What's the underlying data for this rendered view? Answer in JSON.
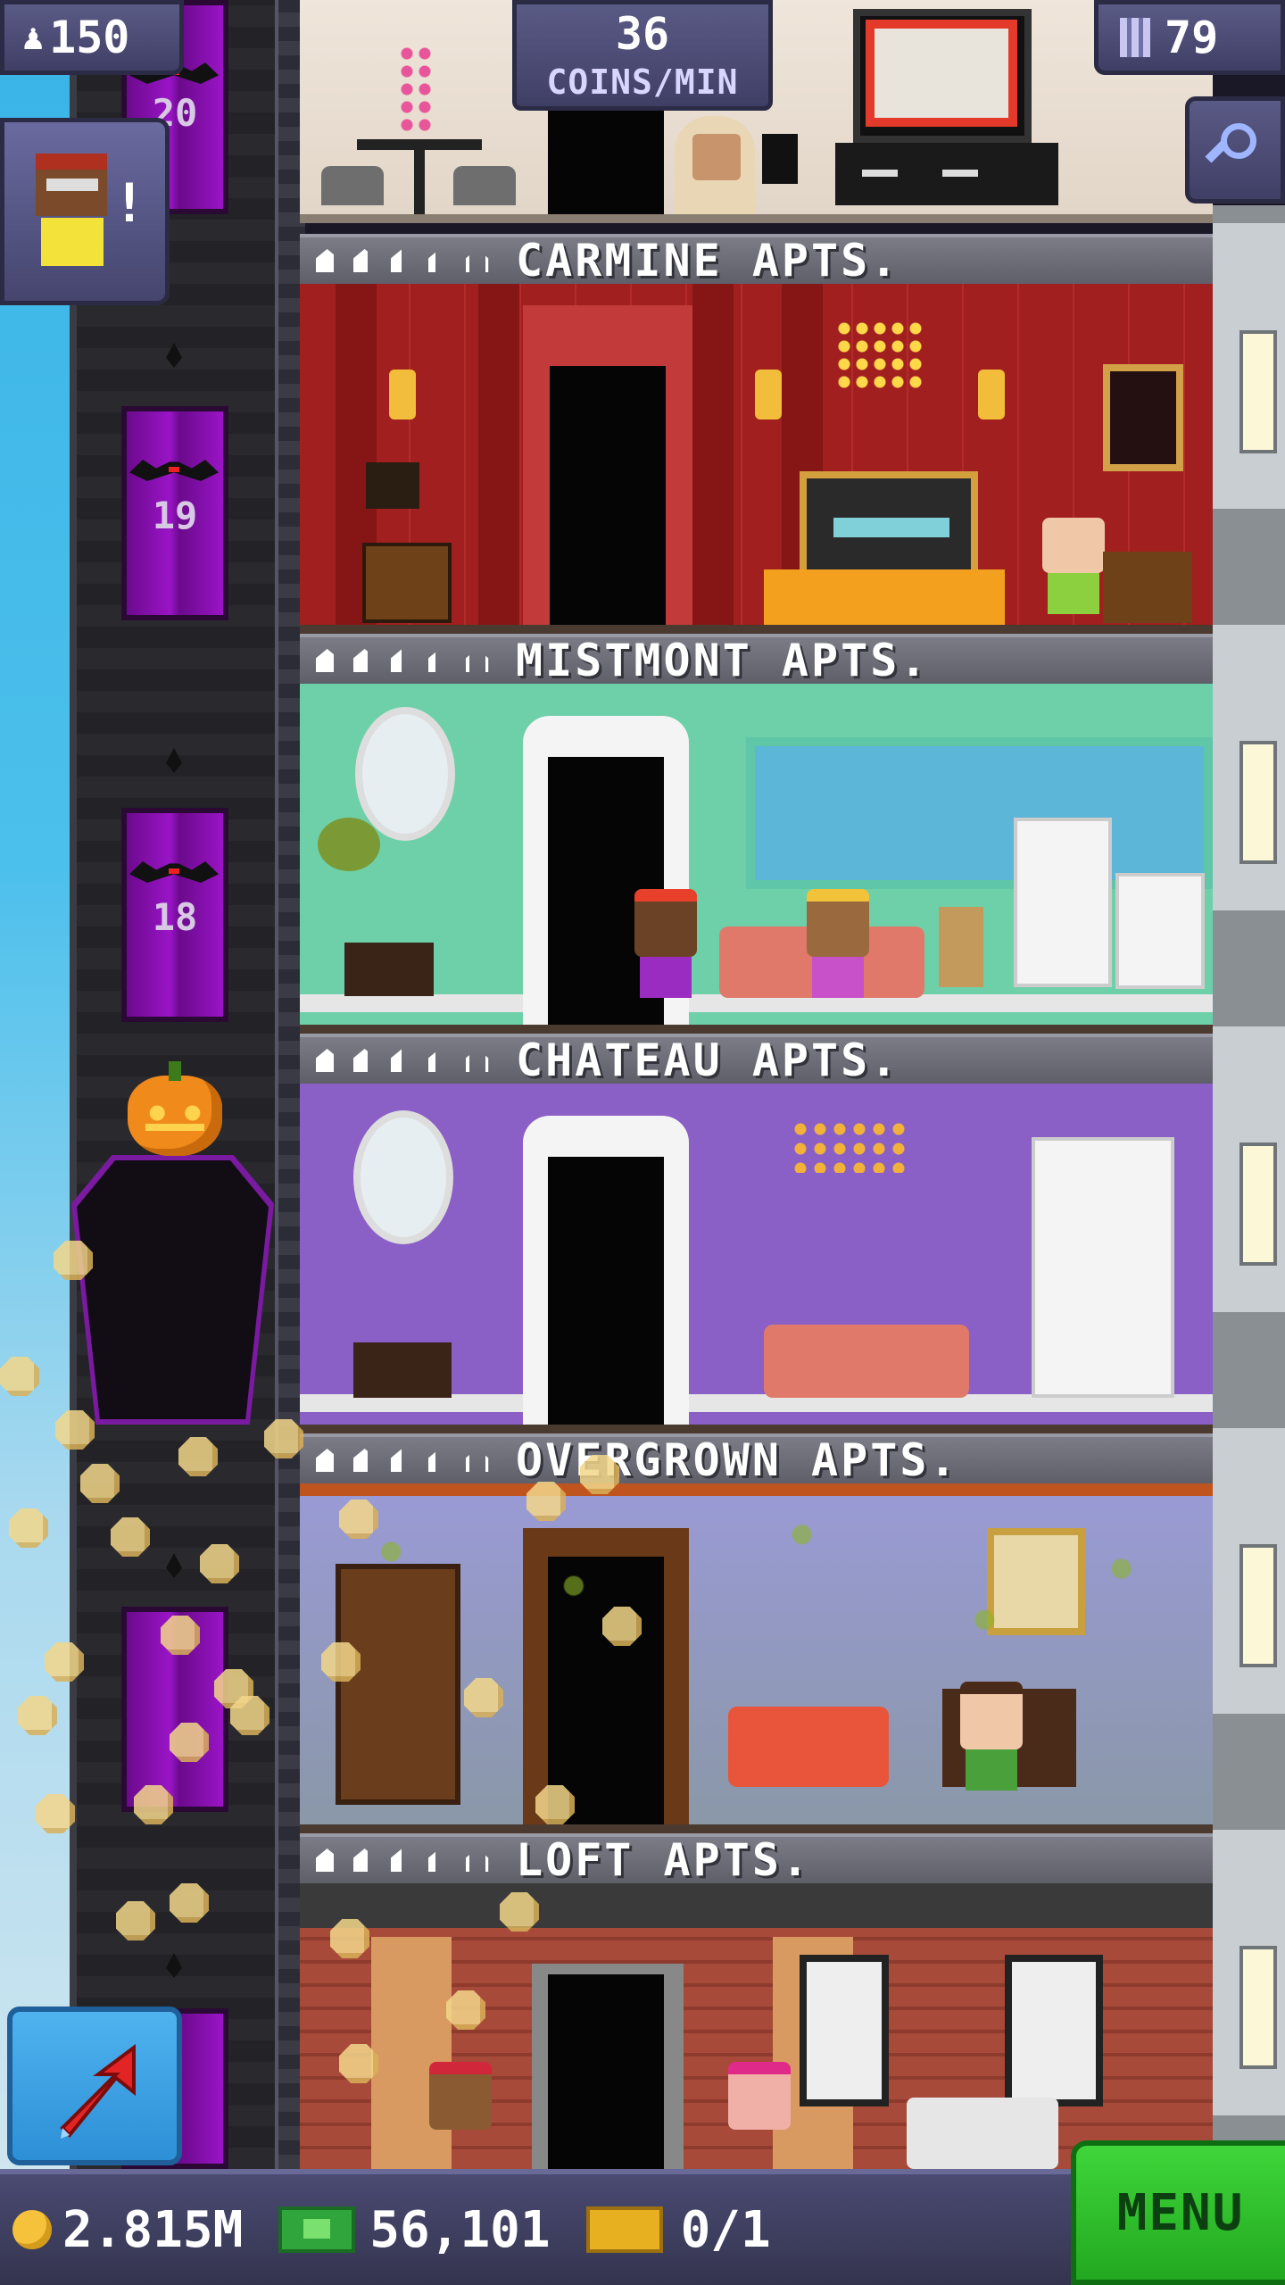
{
  "hud": {
    "population": "150",
    "coins_per_min_value": "36",
    "coins_per_min_unit": "COINS/MIN",
    "floor_count": "79"
  },
  "elevator": {
    "floor_numbers": [
      "20",
      "19",
      "18"
    ]
  },
  "floors": [
    {
      "name": "CARMINE APTS.",
      "theme_color": "#b32626"
    },
    {
      "name": "MISTMONT APTS.",
      "theme_color": "#5fc7a0"
    },
    {
      "name": "CHATEAU APTS.",
      "theme_color": "#8c63c9"
    },
    {
      "name": "OVERGROWN APTS.",
      "theme_color": "#8f8fc8"
    },
    {
      "name": "LOFT APTS.",
      "theme_color": "#b0503e"
    }
  ],
  "bottom_bar": {
    "coins": "2.815M",
    "bux": "56,101",
    "tickets": "0/1",
    "menu_label": "MENU"
  },
  "icons": {
    "population": "person-up-icon",
    "floors": "building-icon",
    "search": "magnifier-icon",
    "elevator_up": "red-arrow-icon",
    "coins": "coin-icon",
    "bux": "bux-bill-icon",
    "tickets": "golden-ticket-icon"
  }
}
